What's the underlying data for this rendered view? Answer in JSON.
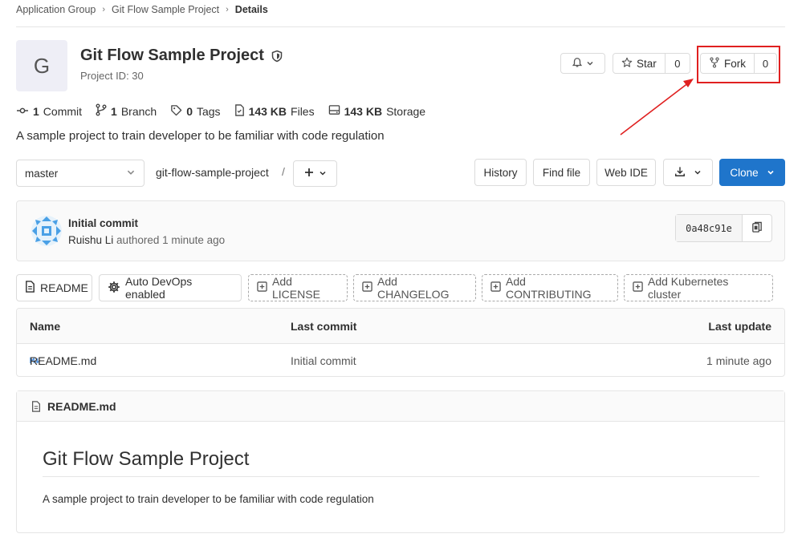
{
  "breadcrumb": {
    "group": "Application Group",
    "project": "Git Flow Sample Project",
    "current": "Details"
  },
  "project": {
    "avatar_letter": "G",
    "title": "Git Flow Sample Project",
    "id_text": "Project ID: 30",
    "description": "A sample project to train developer to be familiar with code regulation"
  },
  "actions": {
    "star_label": "Star",
    "star_count": "0",
    "fork_label": "Fork",
    "fork_count": "0"
  },
  "stats": {
    "commits_count": "1",
    "commits_label": "Commit",
    "branches_count": "1",
    "branches_label": "Branch",
    "tags_count": "0",
    "tags_label": "Tags",
    "files_size": "143 KB",
    "files_label": "Files",
    "storage_size": "143 KB",
    "storage_label": "Storage"
  },
  "repo_bar": {
    "branch": "master",
    "path": "git-flow-sample-project",
    "path_sep": "/",
    "history": "History",
    "find_file": "Find file",
    "web_ide": "Web IDE",
    "clone": "Clone"
  },
  "commit": {
    "title": "Initial commit",
    "author": "Ruishu Li",
    "meta": "authored 1 minute ago",
    "sha": "0a48c91e"
  },
  "quick_actions": [
    {
      "label": "README"
    },
    {
      "label": "Auto DevOps enabled"
    },
    {
      "label": "Add LICENSE"
    },
    {
      "label": "Add CHANGELOG"
    },
    {
      "label": "Add CONTRIBUTING"
    },
    {
      "label": "Add Kubernetes cluster"
    }
  ],
  "file_table": {
    "headers": {
      "name": "Name",
      "last_commit": "Last commit",
      "last_update": "Last update"
    },
    "rows": [
      {
        "name": "README.md",
        "last_commit": "Initial commit",
        "last_update": "1 minute ago"
      }
    ]
  },
  "readme": {
    "filename": "README.md",
    "heading": "Git Flow Sample Project",
    "body": "A sample project to train developer to be familiar with code regulation"
  },
  "colors": {
    "primary": "#1f75cb",
    "annotation": "#e02020"
  }
}
